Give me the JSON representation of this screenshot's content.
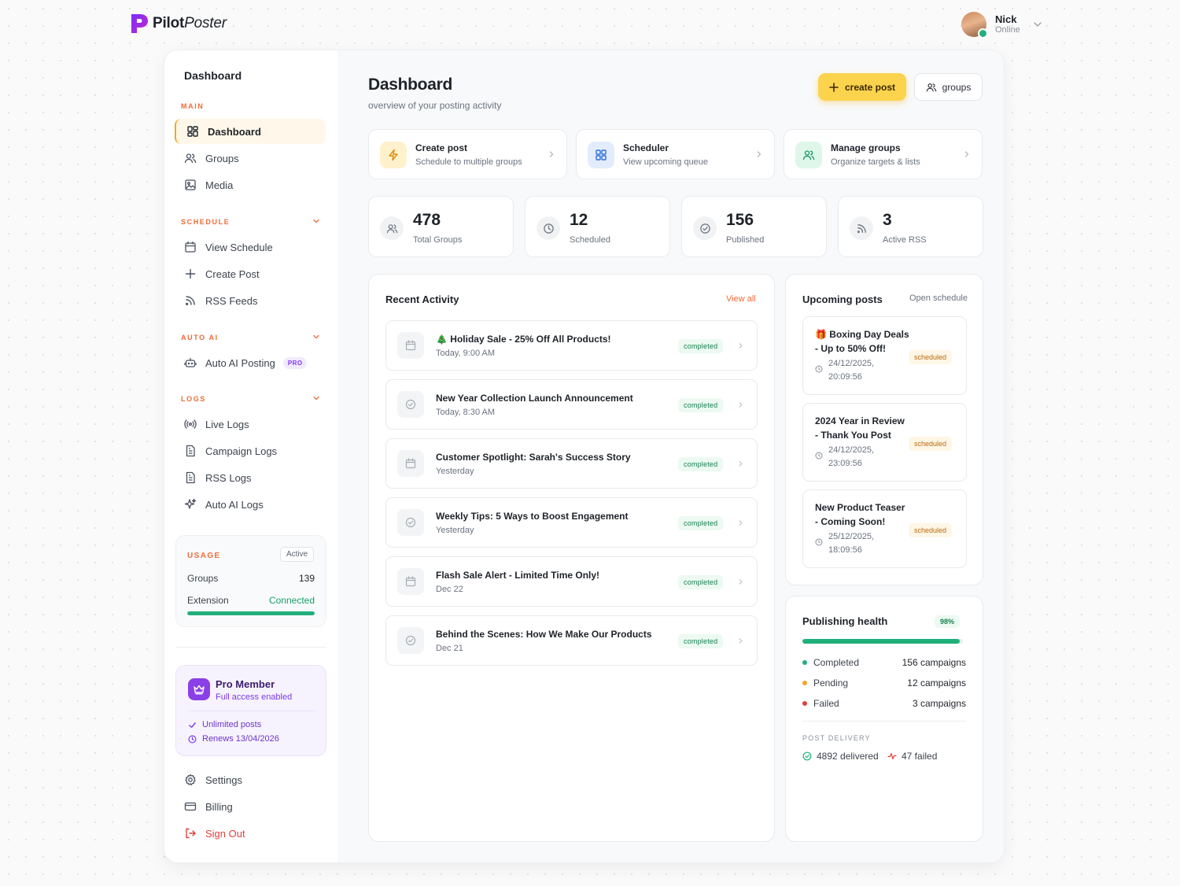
{
  "brand": {
    "name_bold": "Pilot",
    "name_rest": "Poster",
    "colors": {
      "logo_gradient": [
        "#7b2ff7",
        "#c026d3"
      ],
      "accent": "#fcd34d"
    }
  },
  "user": {
    "name": "Nick",
    "status": "Online"
  },
  "sidebar": {
    "title": "Dashboard",
    "sections": {
      "main": "MAIN",
      "schedule": "SCHEDULE",
      "auto_ai": "AUTO AI",
      "logs": "LOGS"
    },
    "items": [
      {
        "label": "Dashboard",
        "icon": "dashboard-grid-icon"
      },
      {
        "label": "Groups",
        "icon": "users-icon"
      },
      {
        "label": "Media",
        "icon": "image-icon"
      },
      {
        "label": "View Schedule",
        "icon": "calendar-icon"
      },
      {
        "label": "Create Post",
        "icon": "plus-icon"
      },
      {
        "label": "RSS Feeds",
        "icon": "rss-icon"
      },
      {
        "label": "Auto AI Posting",
        "icon": "bot-icon",
        "badge": "PRO"
      },
      {
        "label": "Live Logs",
        "icon": "broadcast-icon"
      },
      {
        "label": "Campaign Logs",
        "icon": "file-icon"
      },
      {
        "label": "RSS Logs",
        "icon": "file-icon"
      },
      {
        "label": "Auto AI Logs",
        "icon": "sparkles-icon"
      }
    ],
    "usage": {
      "title": "USAGE",
      "badge": "Active",
      "groups_label": "Groups",
      "groups_value": "139",
      "extension_label": "Extension",
      "extension_value": "Connected",
      "progress": 1.0
    },
    "pro": {
      "title": "Pro Member",
      "subtitle": "Full access enabled",
      "feature": "Unlimited posts",
      "renews": "Renews 13/04/2026"
    },
    "bottom": [
      {
        "label": "Settings",
        "icon": "gear-icon"
      },
      {
        "label": "Billing",
        "icon": "credit-card-icon"
      },
      {
        "label": "Sign Out",
        "icon": "logout-icon"
      }
    ]
  },
  "header": {
    "title": "Dashboard",
    "subtitle": "overview of your posting activity",
    "create_label": "create post",
    "groups_label": "groups"
  },
  "quick_actions": [
    {
      "title": "Create post",
      "subtitle": "Schedule to multiple groups",
      "icon": "lightning-icon"
    },
    {
      "title": "Scheduler",
      "subtitle": "View upcoming queue",
      "icon": "grid-icon"
    },
    {
      "title": "Manage groups",
      "subtitle": "Organize targets & lists",
      "icon": "users-icon"
    }
  ],
  "stats": [
    {
      "value": "478",
      "label": "Total Groups",
      "icon": "users-icon"
    },
    {
      "value": "12",
      "label": "Scheduled",
      "icon": "clock-icon"
    },
    {
      "value": "156",
      "label": "Published",
      "icon": "check-circle-icon"
    },
    {
      "value": "3",
      "label": "Active RSS",
      "icon": "rss-icon"
    }
  ],
  "recent_activity": {
    "title": "Recent Activity",
    "link": "View all",
    "items": [
      {
        "title": "🎄 Holiday Sale - 25% Off All Products!",
        "time": "Today, 9:00 AM",
        "status": "completed",
        "icon": "calendar-icon"
      },
      {
        "title": "New Year Collection Launch Announcement",
        "time": "Today, 8:30 AM",
        "status": "completed",
        "icon": "check-circle-icon"
      },
      {
        "title": "Customer Spotlight: Sarah's Success Story",
        "time": "Yesterday",
        "status": "completed",
        "icon": "calendar-icon"
      },
      {
        "title": "Weekly Tips: 5 Ways to Boost Engagement",
        "time": "Yesterday",
        "status": "completed",
        "icon": "check-circle-icon"
      },
      {
        "title": "Flash Sale Alert - Limited Time Only!",
        "time": "Dec 22",
        "status": "completed",
        "icon": "calendar-icon"
      },
      {
        "title": "Behind the Scenes: How We Make Our Products",
        "time": "Dec 21",
        "status": "completed",
        "icon": "check-circle-icon"
      }
    ]
  },
  "upcoming": {
    "title": "Upcoming posts",
    "link": "Open schedule",
    "items": [
      {
        "title": "🎁 Boxing Day Deals - Up to 50% Off!",
        "date": "24/12/2025, 20:09:56",
        "status": "scheduled"
      },
      {
        "title": "2024 Year in Review - Thank You Post",
        "date": "24/12/2025, 23:09:56",
        "status": "scheduled"
      },
      {
        "title": "New Product Teaser - Coming Soon!",
        "date": "25/12/2025, 18:09:56",
        "status": "scheduled"
      }
    ]
  },
  "health": {
    "title": "Publishing health",
    "percent_label": "98%",
    "percent": 0.98,
    "rows": [
      {
        "label": "Completed",
        "value": "156 campaigns",
        "color": "#1fb07a"
      },
      {
        "label": "Pending",
        "value": "12 campaigns",
        "color": "#f5a623"
      },
      {
        "label": "Failed",
        "value": "3 campaigns",
        "color": "#e2413b"
      }
    ],
    "delivery_title": "POST DELIVERY",
    "delivered": "4892 delivered",
    "failed": "47 failed"
  }
}
